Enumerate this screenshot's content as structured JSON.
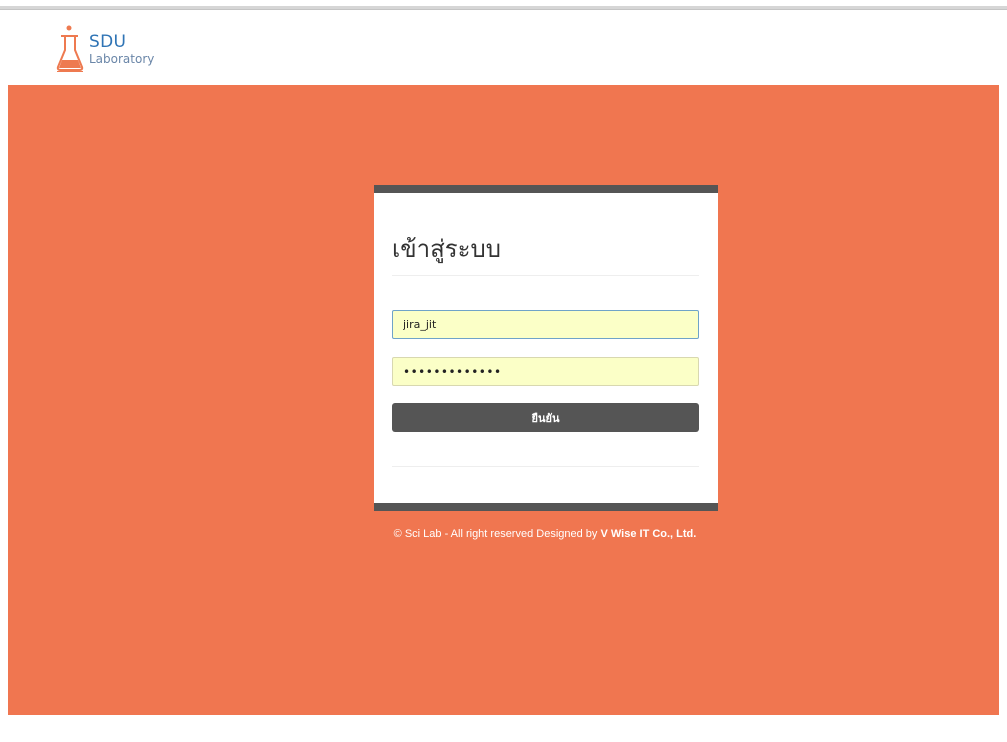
{
  "header": {
    "logo_title": "SDU",
    "logo_subtitle": "Laboratory",
    "logo_icon": "flask-icon"
  },
  "login": {
    "title": "เข้าสู่ระบบ",
    "username_value": "jira_jit",
    "password_value": "•••••••••••••",
    "submit_label": "ยืนยัน"
  },
  "footer": {
    "text": "© Sci Lab - All right reserved Designed by ",
    "company": "V Wise IT Co., Ltd."
  },
  "colors": {
    "background": "#f07650",
    "card_bar": "#555555",
    "autofill": "#fbffc7",
    "brand_blue": "#2f74b5",
    "flask_orange": "#ee7a50"
  }
}
